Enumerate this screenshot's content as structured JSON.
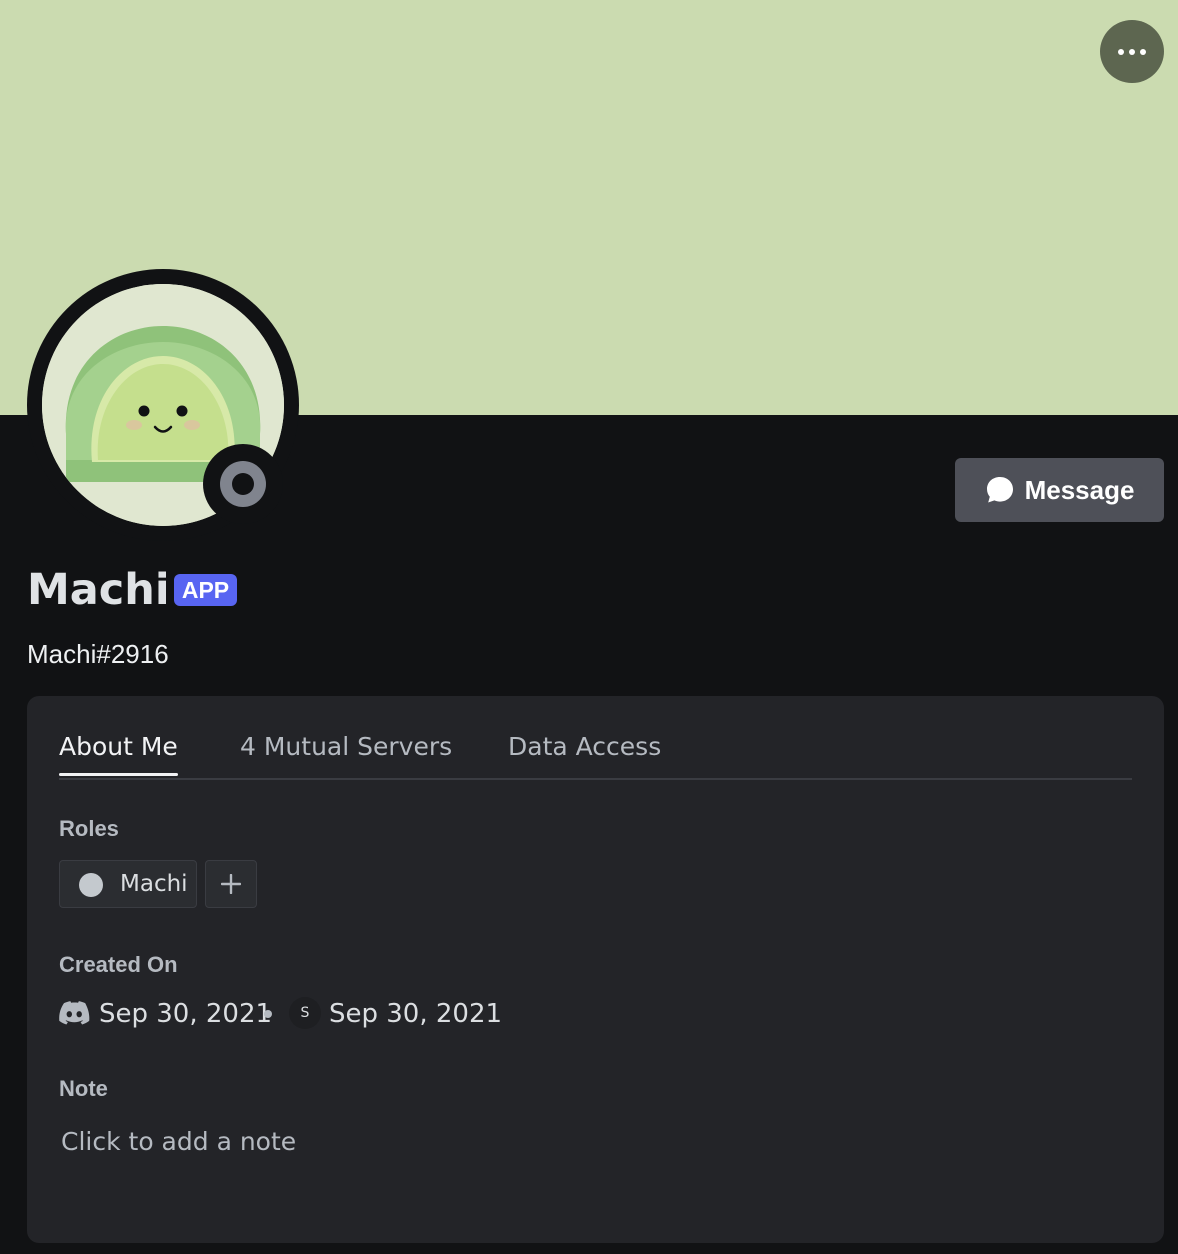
{
  "profile": {
    "display_name": "Machi",
    "badge": "APP",
    "username": "Machi#2916",
    "status": "offline",
    "banner_color": "#cbdbb0"
  },
  "header": {
    "more_icon": "more-horizontal-icon"
  },
  "actions": {
    "message_label": "Message",
    "message_icon": "chat-bubble-icon"
  },
  "tabs": [
    {
      "label": "About Me",
      "active": true
    },
    {
      "label": "4 Mutual Servers",
      "active": false
    },
    {
      "label": "Data Access",
      "active": false
    }
  ],
  "roles": {
    "title": "Roles",
    "items": [
      {
        "name": "Machi",
        "color": "#c4c9ce"
      }
    ],
    "add_icon": "plus-icon"
  },
  "created": {
    "title": "Created On",
    "discord_date": "Sep 30, 2021",
    "server_initial": "S",
    "server_date": "Sep 30, 2021"
  },
  "note": {
    "title": "Note",
    "placeholder": "Click to add a note"
  },
  "colors": {
    "accent": "#5865f2",
    "background": "#111214",
    "card": "#232428"
  }
}
